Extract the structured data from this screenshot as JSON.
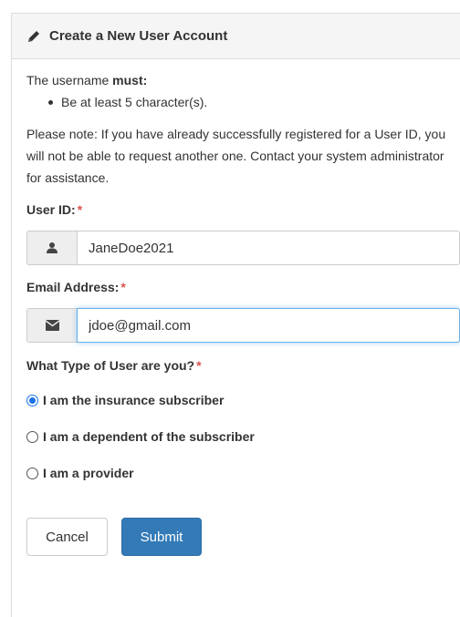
{
  "header": {
    "title": "Create a New User Account",
    "icon": "pencil-icon"
  },
  "rules": {
    "intro_prefix": "The username ",
    "intro_bold": "must:",
    "items": [
      "Be at least 5 character(s)."
    ]
  },
  "note": "Please note: If you have already successfully registered for a User ID, you will not be able to request another one. Contact your system administrator for assistance.",
  "user_id": {
    "label": "User ID:",
    "required_mark": "*",
    "value": "JaneDoe2021",
    "icon": "user-icon"
  },
  "email": {
    "label": "Email Address:",
    "required_mark": "*",
    "value": "jdoe@gmail.com",
    "icon": "envelope-icon"
  },
  "user_type": {
    "label": "What Type of User are you?",
    "required_mark": "*",
    "options": [
      {
        "label": "I am the insurance subscriber",
        "checked": true
      },
      {
        "label": "I am a dependent of the subscriber",
        "checked": false
      },
      {
        "label": "I am a provider",
        "checked": false
      }
    ]
  },
  "buttons": {
    "cancel": "Cancel",
    "submit": "Submit"
  },
  "colors": {
    "primary": "#337ab7",
    "required": "#d9534f",
    "focus": "#66afe9",
    "radio_checked": "#1a73e8"
  }
}
